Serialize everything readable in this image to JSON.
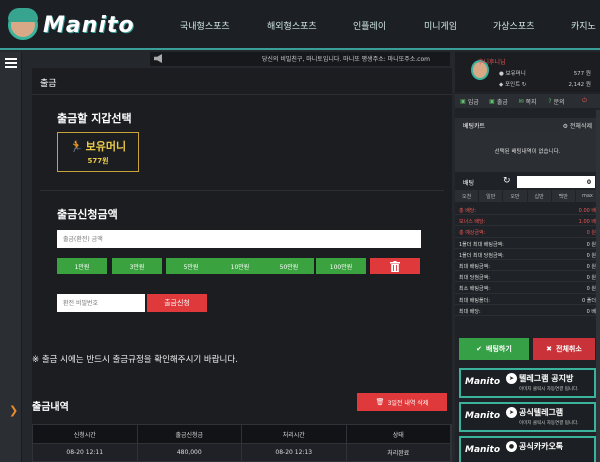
{
  "header": {
    "logo_text": "Manito",
    "nav": [
      "국내형스포츠",
      "해외형스포츠",
      "인플레이",
      "미니게임",
      "가상스포츠",
      "카지노"
    ]
  },
  "ticker": {
    "text": "당신의 비밀친구, 마니토입니다. 마니또 평생주소: 마니또주소.com"
  },
  "main": {
    "page_title": "출금",
    "wallet_section_title": "출금할 지갑선택",
    "wallet": {
      "name": "보유머니",
      "amount": "577원"
    },
    "amount_section_title": "출금신청금액",
    "amount_placeholder": "출금(환전) 금액",
    "chips": [
      "1만원",
      "3만원",
      "5만원",
      "10만원",
      "50만원",
      "100만원"
    ],
    "password_placeholder": "환전 비밀번호",
    "submit_label": "출금신청",
    "notice": "※ 출금 시에는 반드시 출금규정을 확인해주시기 바랍니다.",
    "history_title": "출금내역",
    "delete_label": "3일전 내역 삭제",
    "table": {
      "headers": [
        "신청시간",
        "출금신청금",
        "처리시간",
        "상태"
      ],
      "rows": [
        [
          "08-20 12:11",
          "480,000",
          "08-20 12:13",
          "처리완료"
        ]
      ]
    }
  },
  "sidebar": {
    "username": "후니후니님",
    "money_label": "보유머니",
    "money_value": "577 원",
    "point_label": "포인트",
    "point_value": "2,142 원",
    "pills": [
      "입금",
      "출금",
      "쪽지",
      "문의"
    ],
    "betcart_label": "베팅카트",
    "betcart_right": "전체삭제",
    "betcart_empty": "선택된 배팅내역이 없습니다.",
    "bet_label": "배팅",
    "bet_input": "0",
    "quick": [
      "오천",
      "일만",
      "오만",
      "십만",
      "백만",
      "max"
    ],
    "info": [
      {
        "k": "총 배당:",
        "v": "0.00 배",
        "hl": true
      },
      {
        "k": "보너스 배당:",
        "v": "1.00 배",
        "hl": true
      },
      {
        "k": "총 예상금액:",
        "v": "0 원",
        "hl": true
      },
      {
        "k": "1폴더 최대 배팅금액:",
        "v": "0 원"
      },
      {
        "k": "1폴더 최대 당첨금액:",
        "v": "0 원"
      },
      {
        "k": "최대 배팅금액:",
        "v": "0 원"
      },
      {
        "k": "최대 당첨금액:",
        "v": "0 원"
      },
      {
        "k": "최소 배팅금액:",
        "v": "0 원"
      },
      {
        "k": "최대 배팅폴더:",
        "v": "0 폴더"
      },
      {
        "k": "최대 배당:",
        "v": "0 배"
      }
    ],
    "bet_button": "배팅하기",
    "clear_button": "전체취소",
    "banners": [
      {
        "logo": "Manito",
        "title": "텔레그램 공지방",
        "sub": "이미지 클릭시 자동연결 됩니다."
      },
      {
        "logo": "Manito",
        "title": "공식텔레그램",
        "sub": "이미지 클릭시 자동연결 됩니다."
      },
      {
        "logo": "Manito",
        "title": "공식카카오톡",
        "sub": ""
      }
    ]
  },
  "colors": {
    "accent_teal": "#3a9e99",
    "green": "#3aa23f",
    "red": "#e0393c",
    "gold": "#e8c94a"
  }
}
